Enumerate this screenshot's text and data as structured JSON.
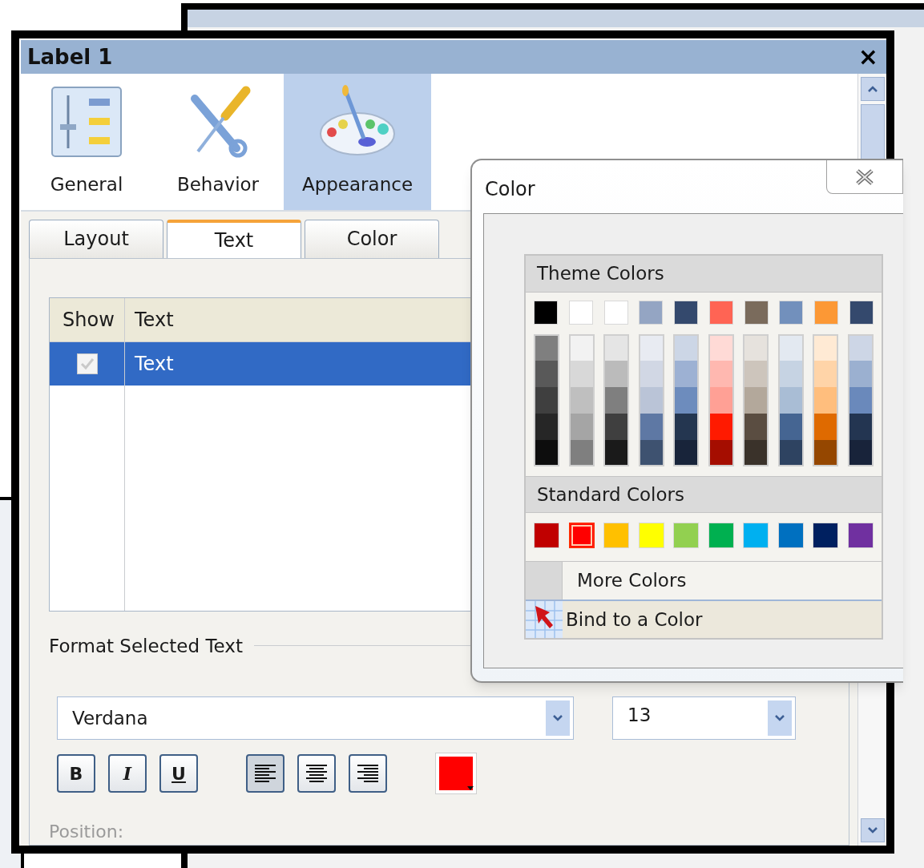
{
  "window": {
    "title": "Label 1",
    "close": "×"
  },
  "categories": [
    {
      "label": "General",
      "kind": "general",
      "selected": false
    },
    {
      "label": "Behavior",
      "kind": "behavior",
      "selected": false
    },
    {
      "label": "Appearance",
      "kind": "appearance",
      "selected": true
    }
  ],
  "tabs": [
    {
      "label": "Layout",
      "selected": false
    },
    {
      "label": "Text",
      "selected": true
    },
    {
      "label": "Color",
      "selected": false
    }
  ],
  "table": {
    "columns": [
      "Show",
      "Text"
    ],
    "rows": [
      {
        "checked": true,
        "text": "Text",
        "selected": true
      }
    ]
  },
  "format": {
    "title": "Format Selected Text",
    "font": {
      "value": "Verdana"
    },
    "size": {
      "value": "13"
    },
    "style_buttons": [
      {
        "label": "B",
        "kind": "bold",
        "selected": false
      },
      {
        "label": "I",
        "kind": "italic",
        "selected": false
      },
      {
        "label": "U",
        "kind": "underline",
        "selected": false
      }
    ],
    "align_buttons": [
      {
        "kind": "left",
        "selected": true
      },
      {
        "kind": "center",
        "selected": false
      },
      {
        "kind": "right",
        "selected": false
      }
    ],
    "color_button": {
      "color": "#ff0000"
    },
    "position_label": "Position:"
  },
  "color_popup": {
    "title": "Color",
    "theme_header": "Theme Colors",
    "theme_top": [
      {
        "color": "#000000"
      },
      {
        "color": "#ffffff"
      },
      {
        "color": "#ffffff"
      },
      {
        "color": "#94a5c3"
      },
      {
        "color": "#34496d"
      },
      {
        "color": "#ff6454"
      },
      {
        "color": "#7a6b5c"
      },
      {
        "color": "#7290bc"
      },
      {
        "color": "#fc9835"
      },
      {
        "color": "#34496d"
      }
    ],
    "theme_shades": [
      {
        "colors": [
          {
            "color": "#7f7f7f"
          },
          {
            "color": "#595959"
          },
          {
            "color": "#3f3f3f"
          },
          {
            "color": "#262626"
          },
          {
            "color": "#0d0d0d"
          }
        ]
      },
      {
        "colors": [
          {
            "color": "#f2f2f2"
          },
          {
            "color": "#d8d8d8"
          },
          {
            "color": "#bfbfbf"
          },
          {
            "color": "#a5a5a5"
          },
          {
            "color": "#7f7f7f"
          }
        ]
      },
      {
        "colors": [
          {
            "color": "#e5e5e5"
          },
          {
            "color": "#bbbbbb"
          },
          {
            "color": "#7f7f7f"
          },
          {
            "color": "#3f3f3f"
          },
          {
            "color": "#1a1a1a"
          }
        ]
      },
      {
        "colors": [
          {
            "color": "#e8ebf2"
          },
          {
            "color": "#d1d7e4"
          },
          {
            "color": "#bac4d7"
          },
          {
            "color": "#5e78a4"
          },
          {
            "color": "#3e5270"
          }
        ]
      },
      {
        "colors": [
          {
            "color": "#ccd6e6"
          },
          {
            "color": "#9db1d3"
          },
          {
            "color": "#6d8cbd"
          },
          {
            "color": "#243650"
          },
          {
            "color": "#18243a"
          }
        ]
      },
      {
        "colors": [
          {
            "color": "#ffdad6"
          },
          {
            "color": "#ffb8b0"
          },
          {
            "color": "#ffa095"
          },
          {
            "color": "#ff1a00"
          },
          {
            "color": "#a50d00"
          }
        ]
      },
      {
        "colors": [
          {
            "color": "#e6e2dd"
          },
          {
            "color": "#cdc5bc"
          },
          {
            "color": "#b3a89b"
          },
          {
            "color": "#5a4d41"
          },
          {
            "color": "#3a322a"
          }
        ]
      },
      {
        "colors": [
          {
            "color": "#e3e9f1"
          },
          {
            "color": "#c6d3e3"
          },
          {
            "color": "#a9bdd5"
          },
          {
            "color": "#456592"
          },
          {
            "color": "#2e4361"
          }
        ]
      },
      {
        "colors": [
          {
            "color": "#ffead4"
          },
          {
            "color": "#ffd4a8"
          },
          {
            "color": "#ffbe7d"
          },
          {
            "color": "#df6a00"
          },
          {
            "color": "#954700"
          }
        ]
      },
      {
        "colors": [
          {
            "color": "#cdd6e6"
          },
          {
            "color": "#9bb0d0"
          },
          {
            "color": "#6a89bb"
          },
          {
            "color": "#233551"
          },
          {
            "color": "#18233a"
          }
        ]
      }
    ],
    "standard_header": "Standard Colors",
    "standard": [
      {
        "color": "#c00000",
        "selected": false
      },
      {
        "color": "#ff0000",
        "selected": true
      },
      {
        "color": "#ffc000",
        "selected": false
      },
      {
        "color": "#ffff00",
        "selected": false
      },
      {
        "color": "#92d050",
        "selected": false
      },
      {
        "color": "#00b050",
        "selected": false
      },
      {
        "color": "#00b0f0",
        "selected": false
      },
      {
        "color": "#0070c0",
        "selected": false
      },
      {
        "color": "#002060",
        "selected": false
      },
      {
        "color": "#7030a0",
        "selected": false
      }
    ],
    "more_colors": "More Colors",
    "bind": "Bind to a Color"
  }
}
